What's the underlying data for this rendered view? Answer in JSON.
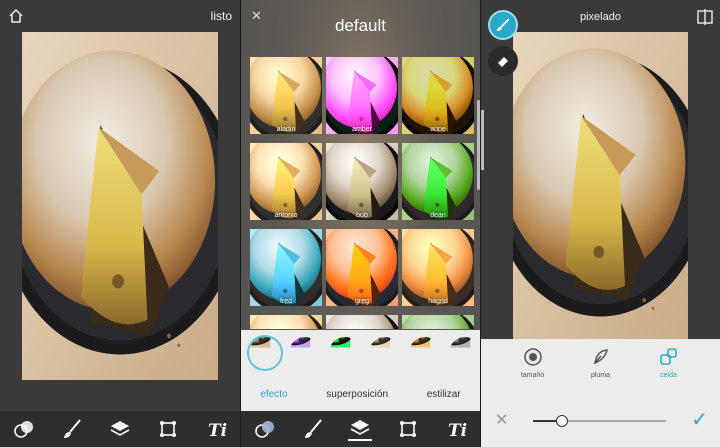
{
  "panel1": {
    "done_label": "listo",
    "home_icon": "home-icon"
  },
  "panel2": {
    "title": "default",
    "close_icon": "close-icon",
    "filters": [
      "aladin",
      "amber",
      "anne",
      "antonio",
      "bob",
      "dean",
      "fred",
      "greg",
      "hagrid"
    ],
    "tabs": [
      "efecto",
      "superposición",
      "estilizar"
    ],
    "active_tab": 0
  },
  "panel3": {
    "title": "pixelado",
    "options": [
      "tamaño",
      "pluma",
      "celda"
    ],
    "active_option": 2,
    "slider_value": 0.22
  },
  "toolbar_icons": [
    "adjust-icon",
    "brush-icon",
    "layers-icon",
    "crop-icon",
    "text-icon"
  ],
  "accent": "#2aa8c8"
}
